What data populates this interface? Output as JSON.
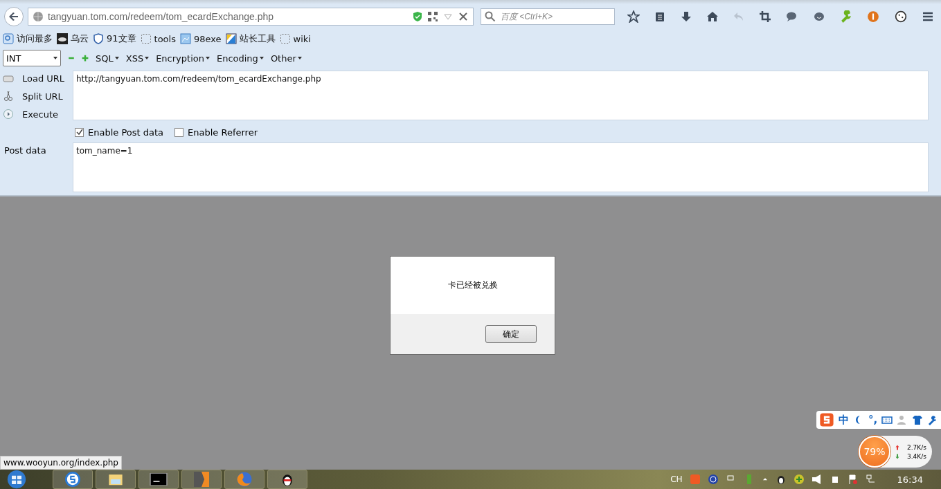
{
  "address_bar": {
    "url": "tangyuan.tom.com/redeem/tom_ecardExchange.php"
  },
  "search": {
    "placeholder": "百度 <Ctrl+K>"
  },
  "bookmarks": [
    {
      "label": "访问最多",
      "kind": "search"
    },
    {
      "label": "乌云",
      "kind": "cloud"
    },
    {
      "label": "91文章",
      "kind": "shield"
    },
    {
      "label": "tools",
      "kind": "empty"
    },
    {
      "label": "98exe",
      "kind": "image"
    },
    {
      "label": "站长工具",
      "kind": "flag"
    },
    {
      "label": "wiki",
      "kind": "empty"
    }
  ],
  "hackbar": {
    "select": "INT",
    "menus": [
      "SQL",
      "XSS",
      "Encryption",
      "Encoding",
      "Other"
    ],
    "actions": [
      {
        "label": "Load URL",
        "kind": "load"
      },
      {
        "label": "Split URL",
        "kind": "split"
      },
      {
        "label": "Execute",
        "kind": "execute"
      }
    ],
    "url_value": "http://tangyuan.tom.com/redeem/tom_ecardExchange.php",
    "options": [
      {
        "label": "Enable Post data",
        "checked": true
      },
      {
        "label": "Enable Referrer",
        "checked": false
      }
    ],
    "post_label": "Post data",
    "post_value": "tom_name=1"
  },
  "dialog": {
    "message": "卡已经被兑换",
    "button": "确定"
  },
  "status_link": "www.wooyun.org/index.php",
  "ime_bar": {
    "mode": "中",
    "punct": "°,"
  },
  "network_widget": {
    "percent": "79%",
    "upload": "2.7K/s",
    "download": "3.4K/s"
  },
  "taskbar": {
    "language": "CH",
    "clock": "16:34"
  }
}
